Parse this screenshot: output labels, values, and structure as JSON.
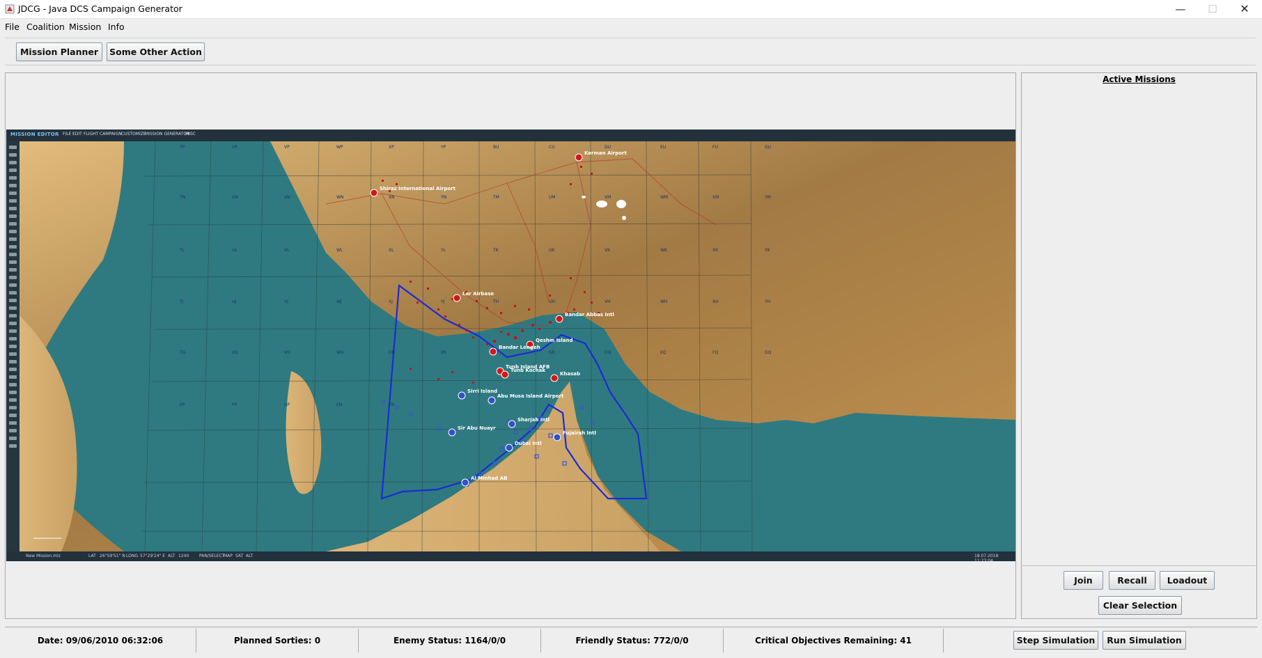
{
  "window": {
    "title": "JDCG - Java DCS Campaign Generator",
    "controls": {
      "minimize": "—",
      "maximize": "☐",
      "close": "✕"
    }
  },
  "menu": [
    "File",
    "Coalition",
    "Mission",
    "Info"
  ],
  "toolbar": {
    "mission_planner": "Mission Planner",
    "other_action": "Some Other Action"
  },
  "map": {
    "editor_title": "MISSION EDITOR",
    "editor_menu": [
      "FILE",
      "EDIT",
      "FLIGHT",
      "CAMPAIGN",
      "CUSTOMIZE",
      "MISSION GENERATOR",
      "MISC"
    ],
    "editor_status": [
      "New Mission.miz",
      "LAT",
      "26°59'51\" N",
      "LONG",
      "57°29'24\" E",
      "ALT",
      "1240",
      "PAN/SELECT",
      "MAP",
      "SAT",
      "ALT"
    ],
    "editor_clock": "18.07.2018 11:23:04",
    "grid_labels": [
      "TP",
      "UP",
      "VP",
      "WP",
      "XP",
      "YP",
      "BU",
      "CU",
      "DU",
      "EU",
      "FU",
      "GU",
      "TN",
      "UN",
      "VN",
      "WN",
      "XN",
      "YN",
      "TM",
      "UM",
      "VM",
      "WM",
      "XM",
      "YM",
      "TL",
      "UL",
      "VL",
      "WL",
      "XL",
      "YL",
      "TK",
      "UK",
      "VK",
      "WK",
      "XK",
      "YK",
      "TJ",
      "UJ",
      "VJ",
      "WJ",
      "XJ",
      "YJ",
      "TH",
      "UH",
      "VH",
      "WH",
      "XH",
      "YH",
      "TG",
      "UG",
      "VG",
      "WG",
      "DR",
      "ER",
      "FR",
      "GR",
      "DQ",
      "EQ",
      "FQ",
      "GQ",
      "EP",
      "FP",
      "GP",
      "EN",
      "FN"
    ],
    "airports": [
      {
        "name": "Kerman Airport",
        "side": "red"
      },
      {
        "name": "Shiraz International Airport",
        "side": "red"
      },
      {
        "name": "Lar Airbase",
        "side": "red"
      },
      {
        "name": "Bandar Abbas Intl",
        "side": "red"
      },
      {
        "name": "Qeshm Island",
        "side": "red"
      },
      {
        "name": "Bandar Lengeh",
        "side": "red"
      },
      {
        "name": "Tunb Island AFB",
        "side": "red"
      },
      {
        "name": "Tunb Kochak",
        "side": "red"
      },
      {
        "name": "Khasab",
        "side": "red"
      },
      {
        "name": "Sirri Island",
        "side": "blue"
      },
      {
        "name": "Abu Musa Island Airport",
        "side": "blue"
      },
      {
        "name": "Sir Abu Nuayr",
        "side": "blue"
      },
      {
        "name": "Sharjah Intl",
        "side": "blue"
      },
      {
        "name": "Dubai Intl",
        "side": "blue"
      },
      {
        "name": "Fujairah Intl",
        "side": "blue"
      },
      {
        "name": "Al Minhad AB",
        "side": "blue"
      }
    ],
    "colors": {
      "sea": "#2f7a80",
      "land": "#c99a56",
      "border_line": "#1a2bd6",
      "red_unit": "#d11818",
      "blue_unit": "#3450c8"
    }
  },
  "right_panel": {
    "title": "Active Missions",
    "buttons": {
      "join": "Join",
      "recall": "Recall",
      "loadout": "Loadout",
      "clear_selection": "Clear Selection"
    }
  },
  "status": {
    "date": "Date: 09/06/2010 06:32:06",
    "planned_sorties": "Planned Sorties: 0",
    "enemy_status": "Enemy Status: 1164/0/0",
    "friendly_status": "Friendly Status: 772/0/0",
    "critical_objectives": "Critical Objectives Remaining: 41",
    "step_simulation": "Step Simulation",
    "run_simulation": "Run Simulation"
  }
}
